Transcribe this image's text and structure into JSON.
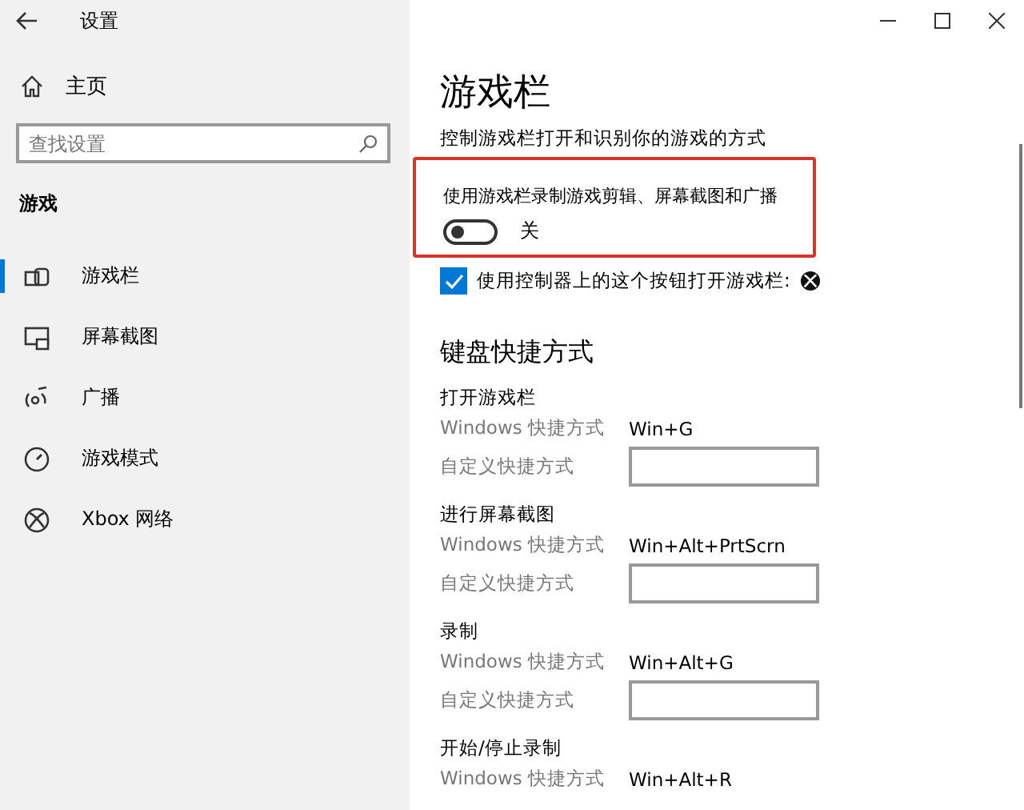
{
  "window": {
    "title": "设置"
  },
  "sidebar": {
    "home": "主页",
    "search": {
      "placeholder": "查找设置"
    },
    "section": "游戏",
    "items": [
      {
        "label": "游戏栏",
        "selected": true
      },
      {
        "label": "屏幕截图",
        "selected": false
      },
      {
        "label": "广播",
        "selected": false
      },
      {
        "label": "游戏模式",
        "selected": false
      },
      {
        "label": "Xbox 网络",
        "selected": false
      }
    ]
  },
  "content": {
    "title": "游戏栏",
    "description": "控制游戏栏打开和识别你的游戏的方式",
    "toggle": {
      "label": "使用游戏栏录制游戏剪辑、屏幕截图和广播",
      "on": false,
      "state_text": "关"
    },
    "checkbox": {
      "label": "使用控制器上的这个按钮打开游戏栏:",
      "checked": true
    },
    "shortcuts": {
      "title": "键盘快捷方式",
      "groups": [
        {
          "title": "打开游戏栏",
          "rows": [
            {
              "kind": "fixed",
              "label": "Windows 快捷方式",
              "value": "Win+G"
            },
            {
              "kind": "input",
              "label": "自定义快捷方式"
            }
          ]
        },
        {
          "title": "进行屏幕截图",
          "rows": [
            {
              "kind": "fixed",
              "label": "Windows 快捷方式",
              "value": "Win+Alt+PrtScrn"
            },
            {
              "kind": "input",
              "label": "自定义快捷方式"
            }
          ]
        },
        {
          "title": "录制",
          "rows": [
            {
              "kind": "fixed",
              "label": "Windows 快捷方式",
              "value": "Win+Alt+G"
            },
            {
              "kind": "input",
              "label": "自定义快捷方式"
            }
          ]
        },
        {
          "title": "开始/停止录制",
          "rows": [
            {
              "kind": "fixed",
              "label": "Windows 快捷方式",
              "value": "Win+Alt+R"
            }
          ]
        }
      ]
    }
  }
}
